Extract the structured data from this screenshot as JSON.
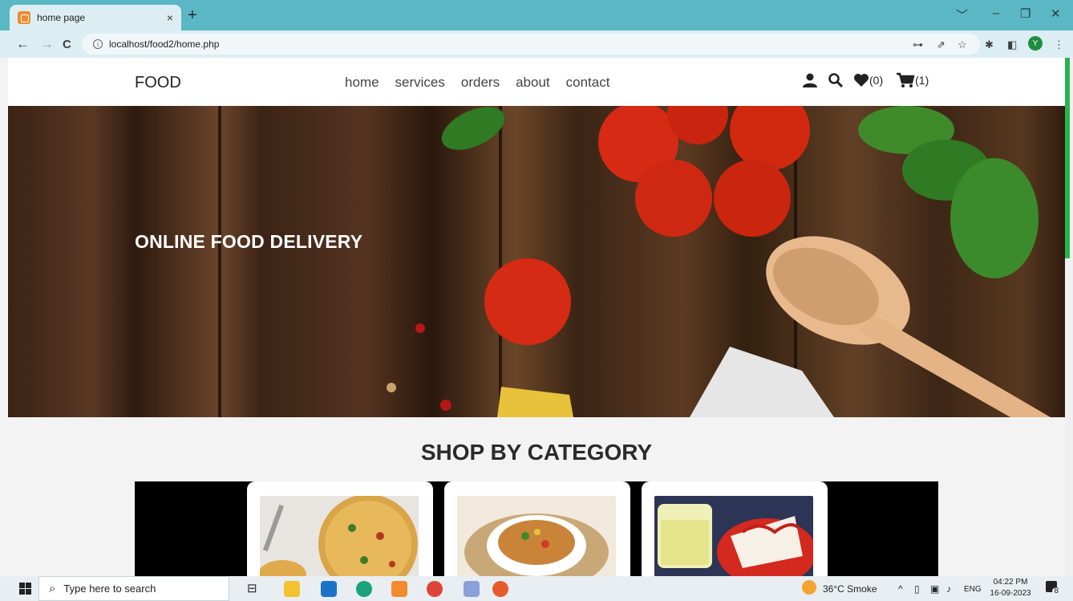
{
  "browser": {
    "tab_title": "home page",
    "tab_close": "×",
    "new_tab": "+",
    "url": "localhost/food2/home.php",
    "back": "←",
    "forward": "→",
    "reload": "C",
    "profile_initial": "Y",
    "window_controls": [
      "﹀",
      "–",
      "❐",
      "✕"
    ]
  },
  "site": {
    "logo": "FOOD",
    "nav": [
      "home",
      "services",
      "orders",
      "about",
      "contact"
    ],
    "wishlist_count": "(0)",
    "cart_count": "(1)"
  },
  "hero": {
    "title": "ONLINE FOOD DELIVERY"
  },
  "category_section": {
    "title": "SHOP BY CATEGORY"
  },
  "taskbar": {
    "search_placeholder": "Type here to search",
    "weather": "36°C  Smoke",
    "language": "ENG",
    "time": "04:22 PM",
    "date": "16-09-2023",
    "notification_count": "8"
  },
  "colors": {
    "browser_frame": "#5bb7c3",
    "toolbar": "#dceef3",
    "accent_scroll": "#2bb24c"
  }
}
